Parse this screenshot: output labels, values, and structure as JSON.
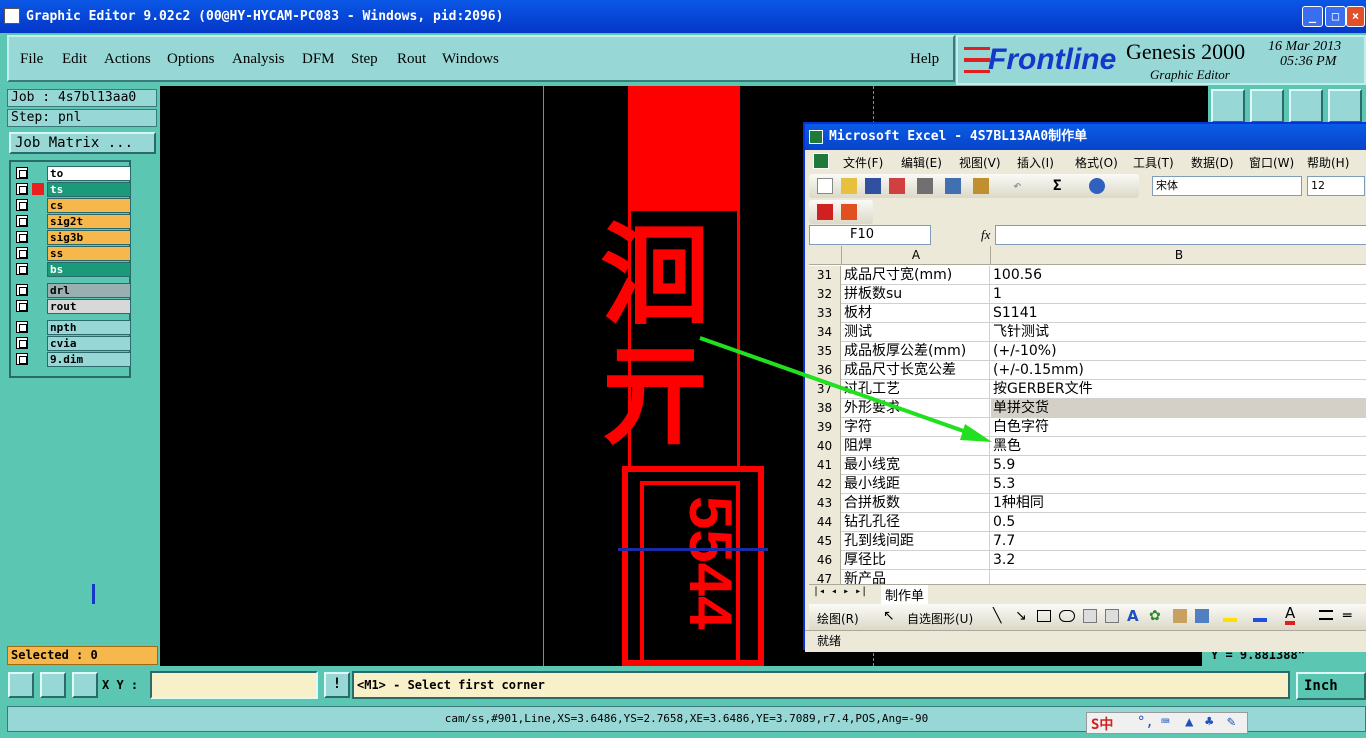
{
  "window": {
    "title": "Graphic Editor 9.02c2 (00@HY-HYCAM-PC083 - Windows, pid:2096)"
  },
  "menu": {
    "items": [
      "File",
      "Edit",
      "Actions",
      "Options",
      "Analysis",
      "DFM",
      "Step",
      "Rout",
      "Windows"
    ],
    "help": "Help"
  },
  "brand": {
    "logo": "Frontline",
    "product": "Genesis 2000",
    "subtitle": "Graphic Editor",
    "date": "16 Mar 2013",
    "time": "05:36 PM"
  },
  "job": {
    "job_label": "Job : 4s7bl13aa0",
    "step_label": "Step: pnl",
    "matrix_button": "Job Matrix ..."
  },
  "layers": [
    {
      "name": "to",
      "color": "#ffffff"
    },
    {
      "name": "ts",
      "color": "#1a9a78"
    },
    {
      "name": "cs",
      "color": "#f6b84c"
    },
    {
      "name": "sig2t",
      "color": "#f6b84c"
    },
    {
      "name": "sig3b",
      "color": "#f6b84c"
    },
    {
      "name": "ss",
      "color": "#f6b84c"
    },
    {
      "name": "bs",
      "color": "#1a9a78"
    },
    {
      "name": "drl",
      "color": "#9ab0b0"
    },
    {
      "name": "rout",
      "color": "#d8d8d8"
    },
    {
      "name": "npth",
      "color": "#97d8d7"
    },
    {
      "name": "cvia",
      "color": "#97d8d7"
    },
    {
      "name": "9.dim",
      "color": "#97d8d7"
    }
  ],
  "selected": "Selected : 0",
  "canvas": {
    "text_vertical": "5544",
    "y_readout": "Y = 9.881388\""
  },
  "bottom": {
    "xy_label": "X Y :",
    "xy_value": "",
    "prompt": "<M1> - Select first corner",
    "units": "Inch",
    "status": "cam/ss,#901,Line,XS=3.6486,YS=2.7658,XE=3.6486,YE=3.7089,r7.4,POS,Ang=-90"
  },
  "ime": {
    "label": "S中"
  },
  "excel": {
    "title": "Microsoft Excel - 4S7BL13AA0制作单",
    "menu": [
      "文件(F)",
      "编辑(E)",
      "视图(V)",
      "插入(I)",
      "格式(O)",
      "工具(T)",
      "数据(D)",
      "窗口(W)",
      "帮助(H)"
    ],
    "font_name": "宋体",
    "font_size": "12",
    "name_box": "F10",
    "fx": "fx",
    "col_a": "A",
    "col_b": "B",
    "rows": [
      {
        "n": "31",
        "a": "成品尺寸宽(mm)",
        "b": "100.56"
      },
      {
        "n": "32",
        "a": "拼板数su",
        "b": "1"
      },
      {
        "n": "33",
        "a": "板材",
        "b": "S1141"
      },
      {
        "n": "34",
        "a": "测试",
        "b": "飞针测试"
      },
      {
        "n": "35",
        "a": "成品板厚公差(mm)",
        "b": "(+/-10%)"
      },
      {
        "n": "36",
        "a": "成品尺寸长宽公差",
        "b": "(+/-0.15mm)"
      },
      {
        "n": "37",
        "a": "过孔工艺",
        "b": "按GERBER文件"
      },
      {
        "n": "38",
        "a": "外形要求",
        "b": "单拼交货"
      },
      {
        "n": "39",
        "a": "字符",
        "b": "白色字符"
      },
      {
        "n": "40",
        "a": "阻焊",
        "b": "黑色"
      },
      {
        "n": "41",
        "a": "最小线宽",
        "b": "5.9"
      },
      {
        "n": "42",
        "a": "最小线距",
        "b": "5.3"
      },
      {
        "n": "43",
        "a": "合拼板数",
        "b": "1种相同"
      },
      {
        "n": "44",
        "a": "钻孔孔径",
        "b": "0.5"
      },
      {
        "n": "45",
        "a": "孔到线间距",
        "b": "7.7"
      },
      {
        "n": "46",
        "a": "厚径比",
        "b": "3.2"
      },
      {
        "n": "47",
        "a": "新产品",
        "b": ""
      }
    ],
    "sheet_tab": "制作单",
    "draw_label": "绘图(R)",
    "autoshape_label": "自选图形(U)",
    "status": "就绪"
  }
}
